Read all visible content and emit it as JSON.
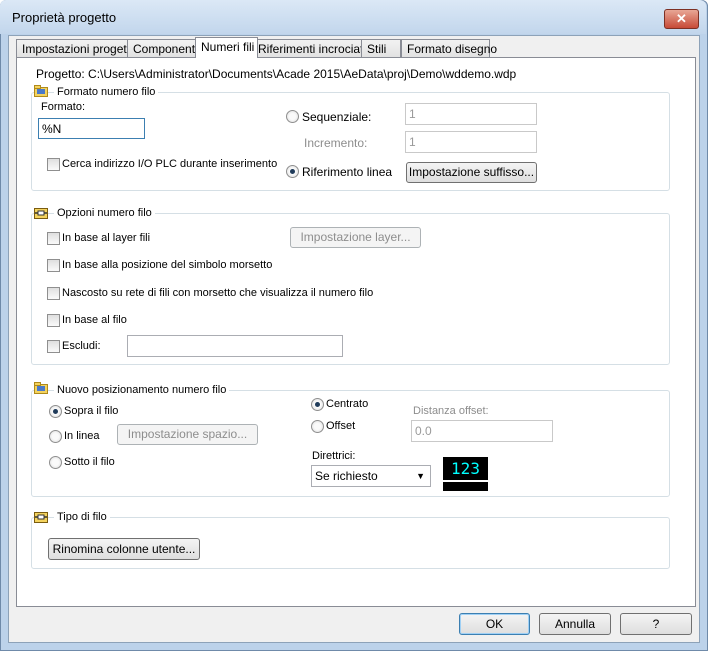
{
  "window": {
    "title": "Proprietà progetto",
    "close_symbol": "✕"
  },
  "tabs": [
    "Impostazioni progetto",
    "Componenti",
    "Numeri fili",
    "Riferimenti incrociati",
    "Stili",
    "Formato disegno"
  ],
  "active_tab": "Numeri fili",
  "project_path": "Progetto: C:\\Users\\Administrator\\Documents\\Acade 2015\\AeData\\proj\\Demo\\wddemo.wdp",
  "wire_number_format": {
    "title": "Formato numero filo",
    "format_label": "Formato:",
    "format_value": "%N",
    "plc_search_label": "Cerca indirizzo I/O PLC durante inserimento",
    "sequential_label": "Sequenziale:",
    "sequential_value": "1",
    "increment_label": "Incremento:",
    "increment_value": "1",
    "line_reference_label": "Riferimento linea",
    "suffix_button": "Impostazione suffisso..."
  },
  "wire_number_options": {
    "title": "Opzioni numero filo",
    "by_layer_label": "In base al layer fili",
    "layer_setup_button": "Impostazione layer...",
    "by_terminal_label": "In base alla posizione del simbolo morsetto",
    "hidden_label": "Nascosto su rete di fili con morsetto che visualizza il numero filo",
    "by_wire_label": "In base al filo",
    "exclude_label": "Escludi:",
    "exclude_value": ""
  },
  "placement": {
    "title": "Nuovo posizionamento numero filo",
    "above_label": "Sopra il filo",
    "inline_label": "In linea",
    "spacing_button": "Impostazione spazio...",
    "below_label": "Sotto il filo",
    "centered_label": "Centrato",
    "offset_label": "Offset",
    "offset_distance_label": "Distanza offset:",
    "offset_distance_value": "0.0",
    "leaders_label": "Direttrici:",
    "leaders_value": "Se richiesto",
    "preview_text": "123"
  },
  "wire_type": {
    "title": "Tipo di filo",
    "rename_button": "Rinomina colonne utente..."
  },
  "footer": {
    "ok": "OK",
    "cancel": "Annulla",
    "help": "?"
  },
  "colors": {
    "preview_bg": "#000000",
    "preview_text": "#00ffff",
    "accent_border": "#3c7fb1"
  }
}
